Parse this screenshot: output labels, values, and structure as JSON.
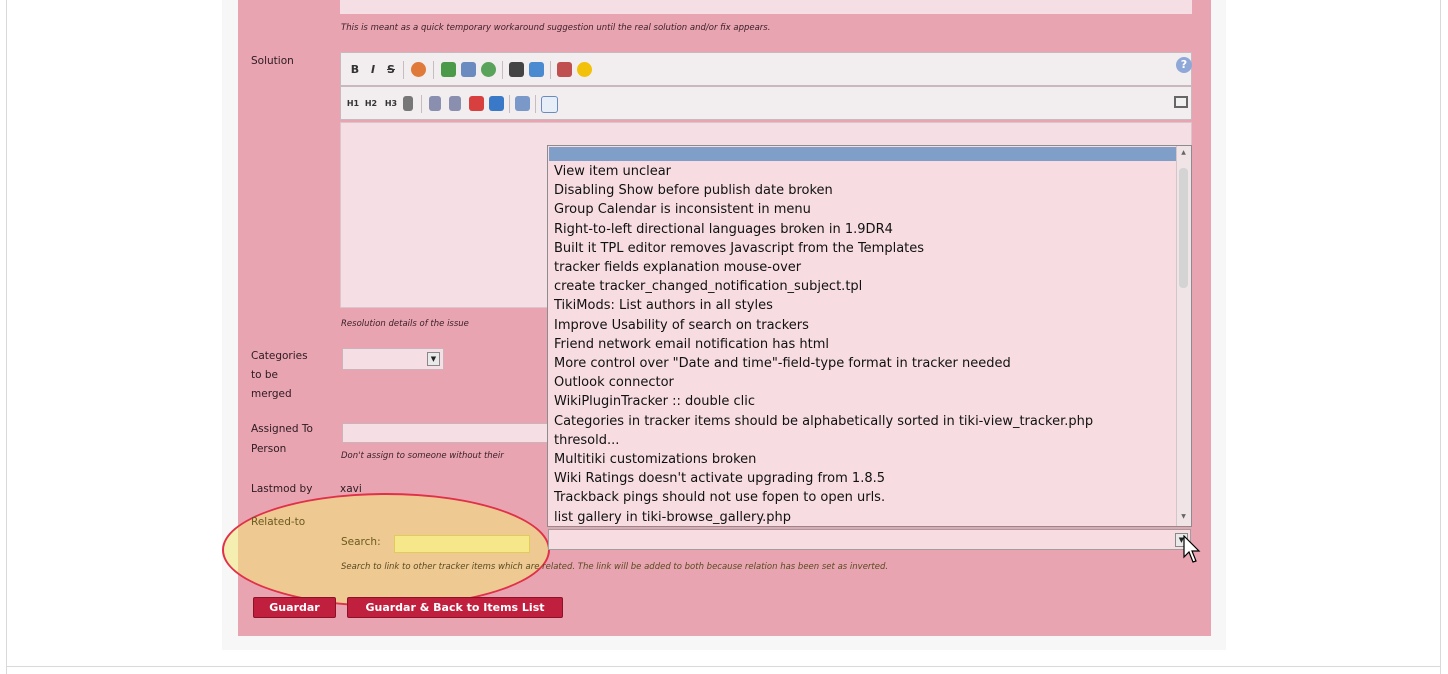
{
  "form": {
    "top_hint": "This is meant as a quick temporary workaround suggestion until the real solution and/or fix appears.",
    "solution_label": "Solution",
    "resolution_hint": "Resolution details of the issue",
    "categories_label_1": "Categories",
    "categories_label_2": "to be",
    "categories_label_3": "merged",
    "assigned_label_1": "Assigned To",
    "assigned_label_2": "Person",
    "assigned_hint": "Don't assign to someone without their",
    "lastmod_label": "Lastmod by",
    "lastmod_value": "xavi",
    "related_label": "Related-to",
    "search_label": "Search:",
    "search_value": "",
    "related_hint": "Search to link to other tracker items which are related. The link will be added to both because relation has been set as inverted."
  },
  "toolbar1": {
    "bold": "B",
    "italic": "I",
    "strike": "S"
  },
  "toolbar2": {
    "h1": "H1",
    "h2": "H2",
    "h3": "H3"
  },
  "related_list": {
    "items": [
      "View item unclear",
      "Disabling Show before publish date broken",
      "Group Calendar is inconsistent in menu",
      "Right-to-left directional languages broken in 1.9DR4",
      "Built it TPL editor removes Javascript from the Templates",
      "tracker fields explanation mouse-over",
      "create tracker_changed_notification_subject.tpl",
      "TikiMods: List authors in all styles",
      "Improve Usability of search on trackers",
      "Friend network email notification has html",
      "More control over \"Date and time\"-field-type format in tracker needed",
      "Outlook connector",
      "WikiPluginTracker :: double clic",
      "Categories in tracker items should be alphabetically sorted in tiki-view_tracker.php",
      "thresold...",
      "Multitiki customizations broken",
      "Wiki Ratings doesn't activate upgrading from 1.8.5",
      "Trackback pings should not use fopen to open urls.",
      "list gallery in tiki-browse_gallery.php"
    ]
  },
  "buttons": {
    "save": "Guardar",
    "save_back": "Guardar & Back to Items List"
  },
  "colors": {
    "panel": "#e8a4b1",
    "button": "#c01f3e",
    "highlight": "#f2ea78",
    "ellipse_border": "#e0304a"
  }
}
